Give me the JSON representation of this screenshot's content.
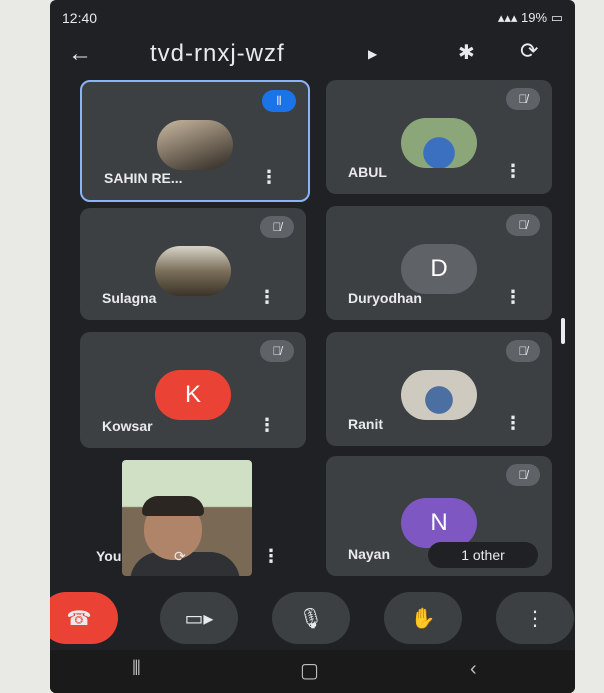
{
  "status_bar": {
    "time": "12:40",
    "battery": "19%"
  },
  "header": {
    "meeting_code": "tvd-rnxj-wzf"
  },
  "participants": [
    {
      "name": "SAHIN RE..."
    },
    {
      "name": "ABUL"
    },
    {
      "name": "Sulagna"
    },
    {
      "name": "Duryodhan",
      "initial": "D"
    },
    {
      "name": "Kowsar",
      "initial": "K"
    },
    {
      "name": "Ranit"
    },
    {
      "name": "You"
    },
    {
      "name": "Nayan",
      "initial": "N"
    }
  ],
  "others_pill": "1 other",
  "colors": {
    "kowsar": "#ea4335",
    "nayan": "#7e57c2",
    "duryodhan": "#3c4043",
    "end_call": "#ea4335"
  },
  "icons": [
    "back-arrow-icon",
    "bluetooth-icon",
    "camera-switch-icon",
    "mic-off-icon",
    "more-vert-icon",
    "video-icon",
    "mic-icon",
    "hand-raise-icon",
    "end-call-icon"
  ]
}
